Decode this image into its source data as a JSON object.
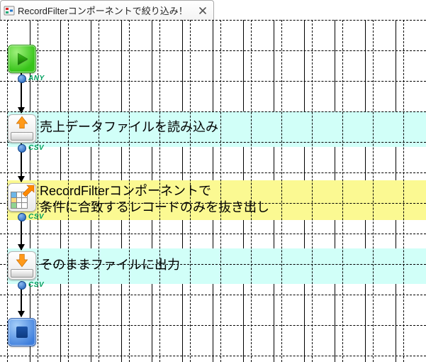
{
  "tab": {
    "title": "RecordFilterコンポーネントで絞り込み！"
  },
  "ports": {
    "any": "ANY",
    "csv": "CSV"
  },
  "steps": {
    "read": "売上データファイルを読み込み",
    "filter_line1": "RecordFilterコンポーネントで",
    "filter_line2": "条件に合致するレコードのみを抜き出し",
    "write": "そのままファイルに出力"
  },
  "colors": {
    "cyan": "#d1fff8",
    "yellow": "#fbf992",
    "port_label": "#00a05e"
  },
  "layout": {
    "grid_cell": 43
  }
}
